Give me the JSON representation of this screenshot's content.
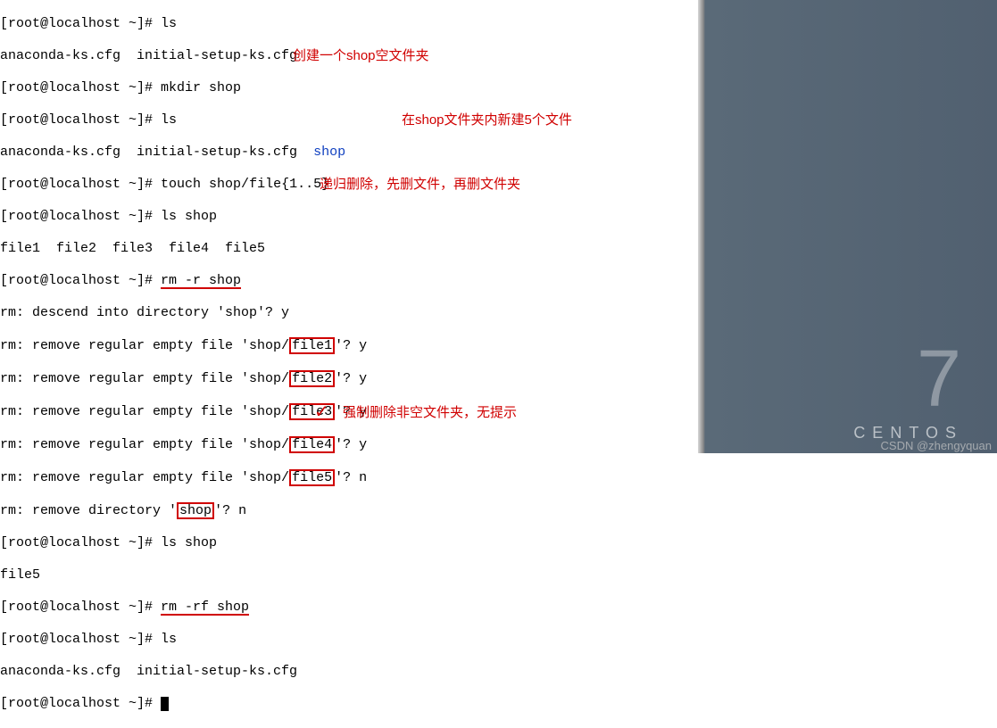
{
  "prompt": "[root@localhost ~]#",
  "lines": {
    "l1_cmd": "ls",
    "l2": "anaconda-ks.cfg  initial-setup-ks.cfg",
    "l3_cmd": "mkdir shop",
    "anno1": "创建一个shop空文件夹",
    "l4_cmd": "ls",
    "l5_pre": "anaconda-ks.cfg  initial-setup-ks.cfg  ",
    "l5_dir": "shop",
    "l6_cmd": "touch shop/file{1..5}",
    "anno2": "在shop文件夹内新建5个文件",
    "l7_cmd": "ls shop",
    "l8": "file1  file2  file3  file4  file5",
    "l9_cmd": "rm -r shop",
    "anno3": "递归删除，先删文件，再删文件夹",
    "l10": "rm: descend into directory 'shop'? y",
    "rm_pre": "rm: remove regular empty file 'shop/",
    "f1": "file1",
    "a1": "'? y",
    "f2": "file2",
    "a2": "'? y",
    "f3": "file3",
    "a3": "'? y",
    "f4": "file4",
    "a4": "'? y",
    "f5": "file5",
    "a5": "'? n",
    "l16_pre": "rm: remove directory '",
    "l16_dir": "shop",
    "l16_post": "'? n",
    "l17_cmd": "ls shop",
    "l18": "file5",
    "l19_cmd": "rm -rf shop",
    "anno4": "强制删除非空文件夹，无提示",
    "check": "✓",
    "l20_cmd": "ls",
    "l21": "anaconda-ks.cfg  initial-setup-ks.cfg",
    "l22_cmd": ""
  },
  "desktop": {
    "big": "7",
    "label": "CENTOS",
    "watermark": "CSDN @zhengyquan"
  }
}
